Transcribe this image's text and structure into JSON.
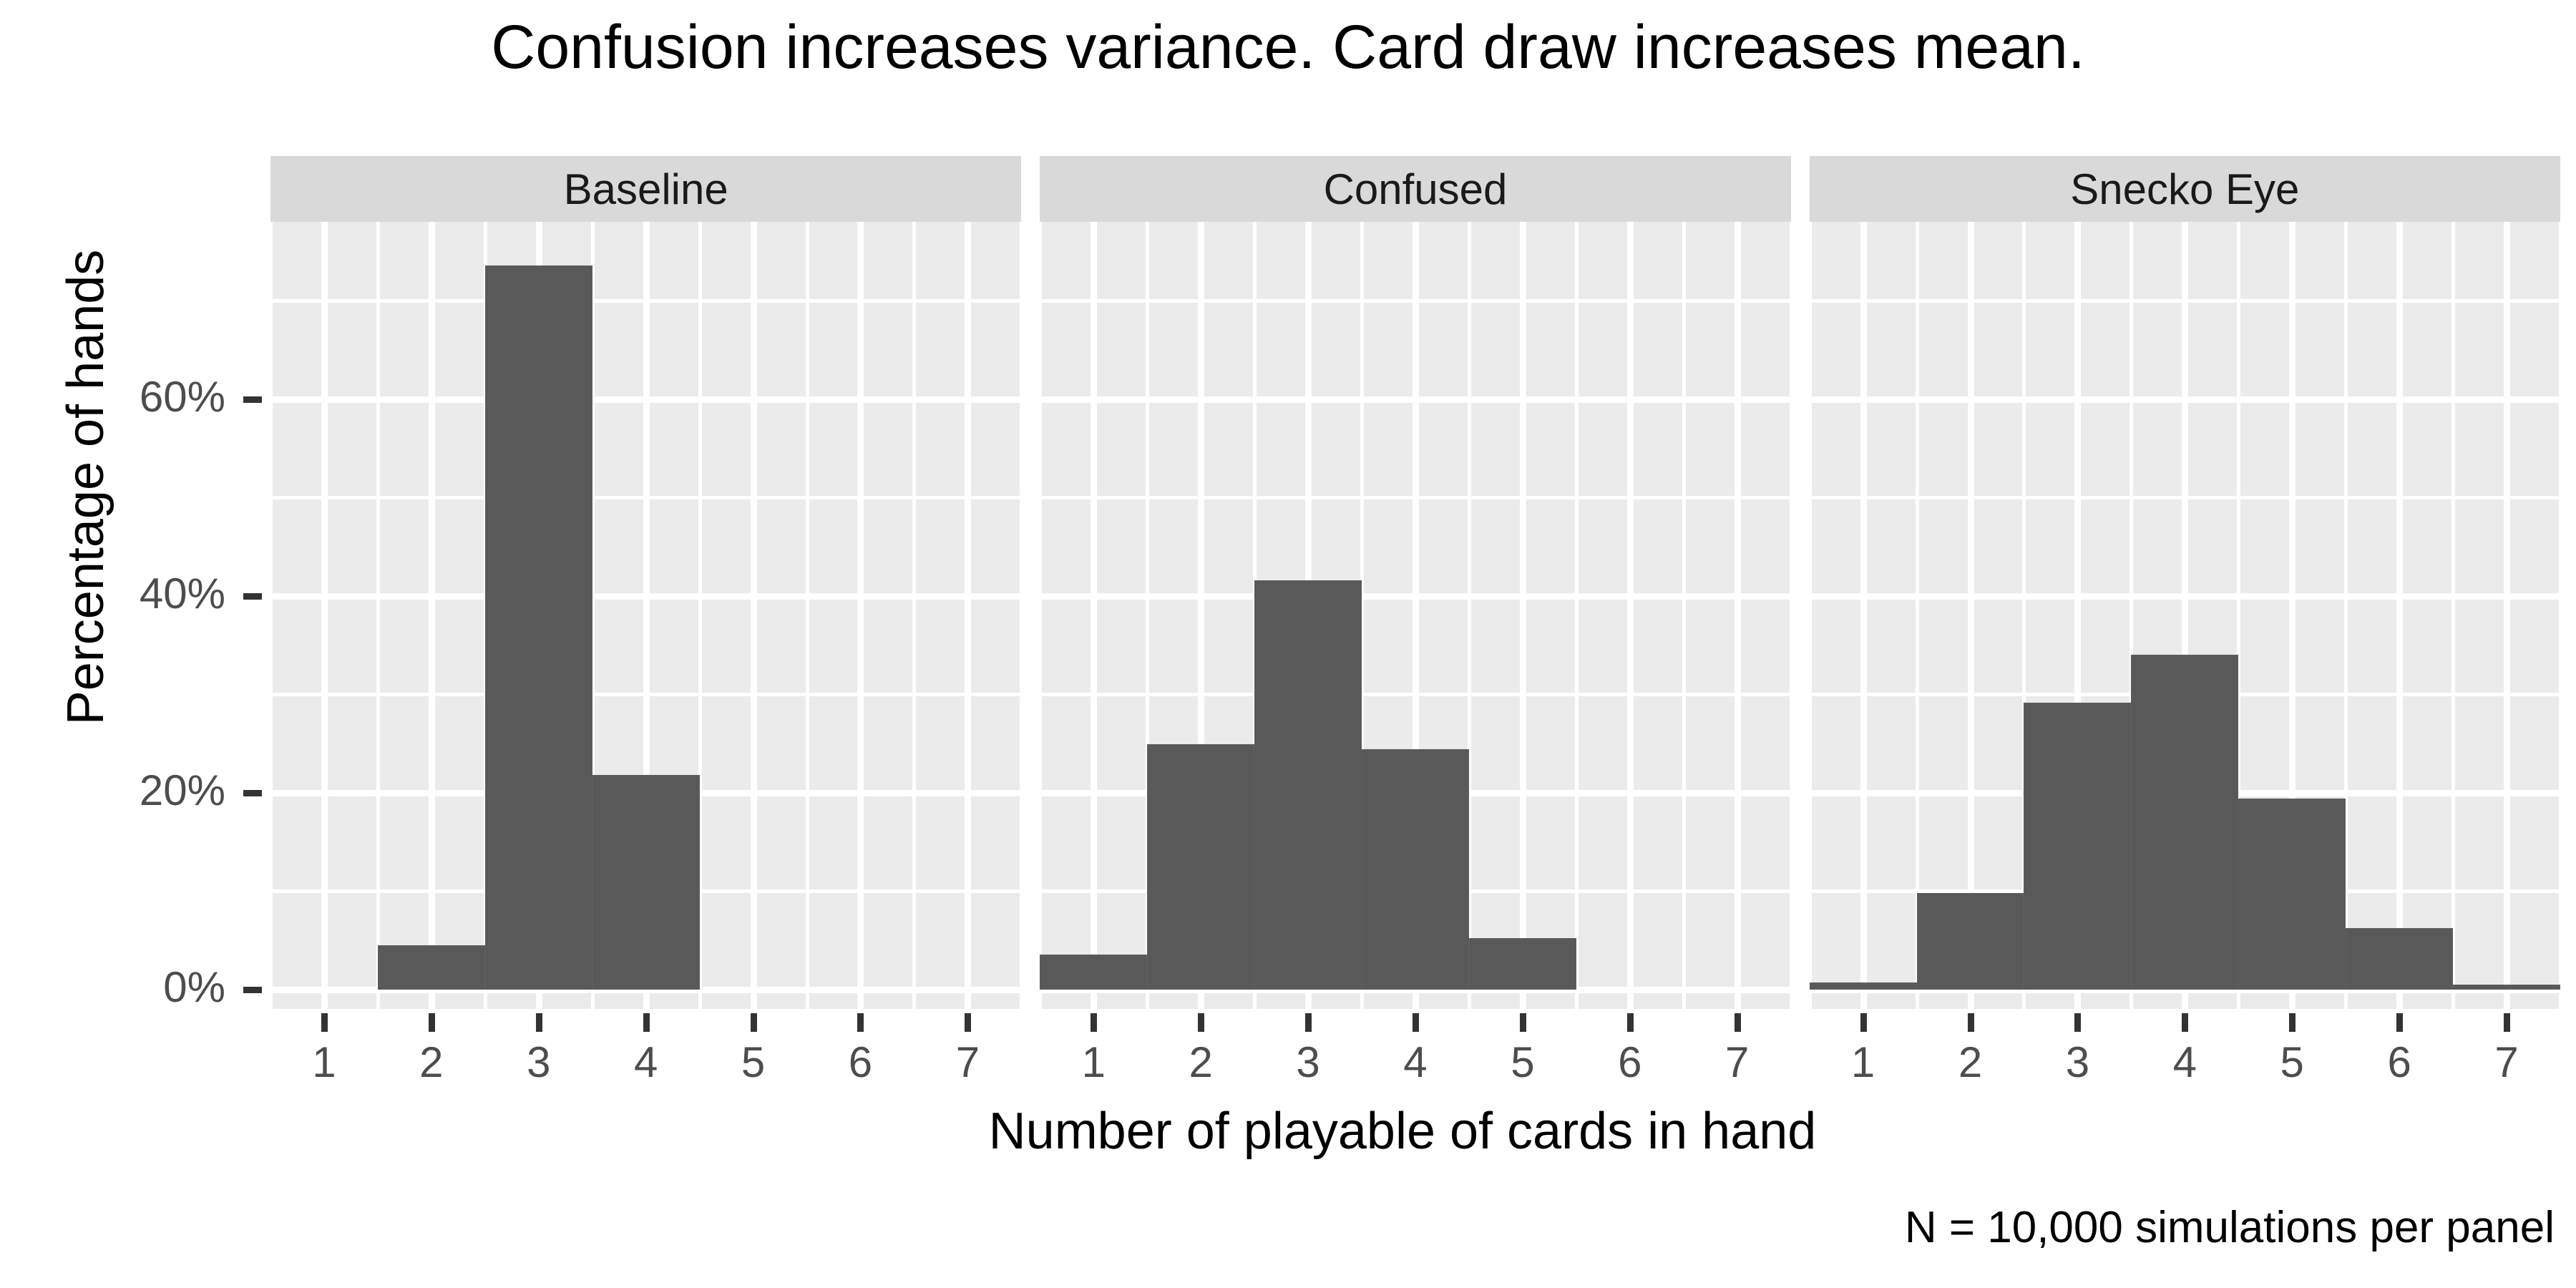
{
  "chart_data": {
    "type": "bar",
    "title": "Confusion increases variance. Card draw increases mean.",
    "xlabel": "Number of playable of cards in hand",
    "ylabel": "Percentage of hands",
    "caption": "N = 10,000 simulations per panel",
    "categories": [
      "1",
      "2",
      "3",
      "4",
      "5",
      "6",
      "7"
    ],
    "ylim": [
      -2,
      78
    ],
    "ytick_values": [
      0,
      20,
      40,
      60
    ],
    "ytick_labels": [
      "0%",
      "20%",
      "40%",
      "60%"
    ],
    "grid": true,
    "legend": "none",
    "facet_variable": "condition",
    "panels": [
      {
        "label": "Baseline",
        "values": [
          0,
          4.5,
          73.6,
          21.8,
          0,
          0,
          0
        ]
      },
      {
        "label": "Confused",
        "values": [
          3.5,
          24.9,
          41.6,
          24.4,
          5.2,
          0,
          0
        ]
      },
      {
        "label": "Snecko Eye",
        "values": [
          0.7,
          9.8,
          29.1,
          34.0,
          19.4,
          6.2,
          0.5
        ]
      }
    ],
    "colors": {
      "bar_fill": "#595959",
      "panel_background": "#ebebeb",
      "strip_background": "#d9d9d9",
      "gridline": "#ffffff",
      "axis_text": "#4d4d4d",
      "title_text": "#000000",
      "figure_background": "#ffffff"
    }
  }
}
